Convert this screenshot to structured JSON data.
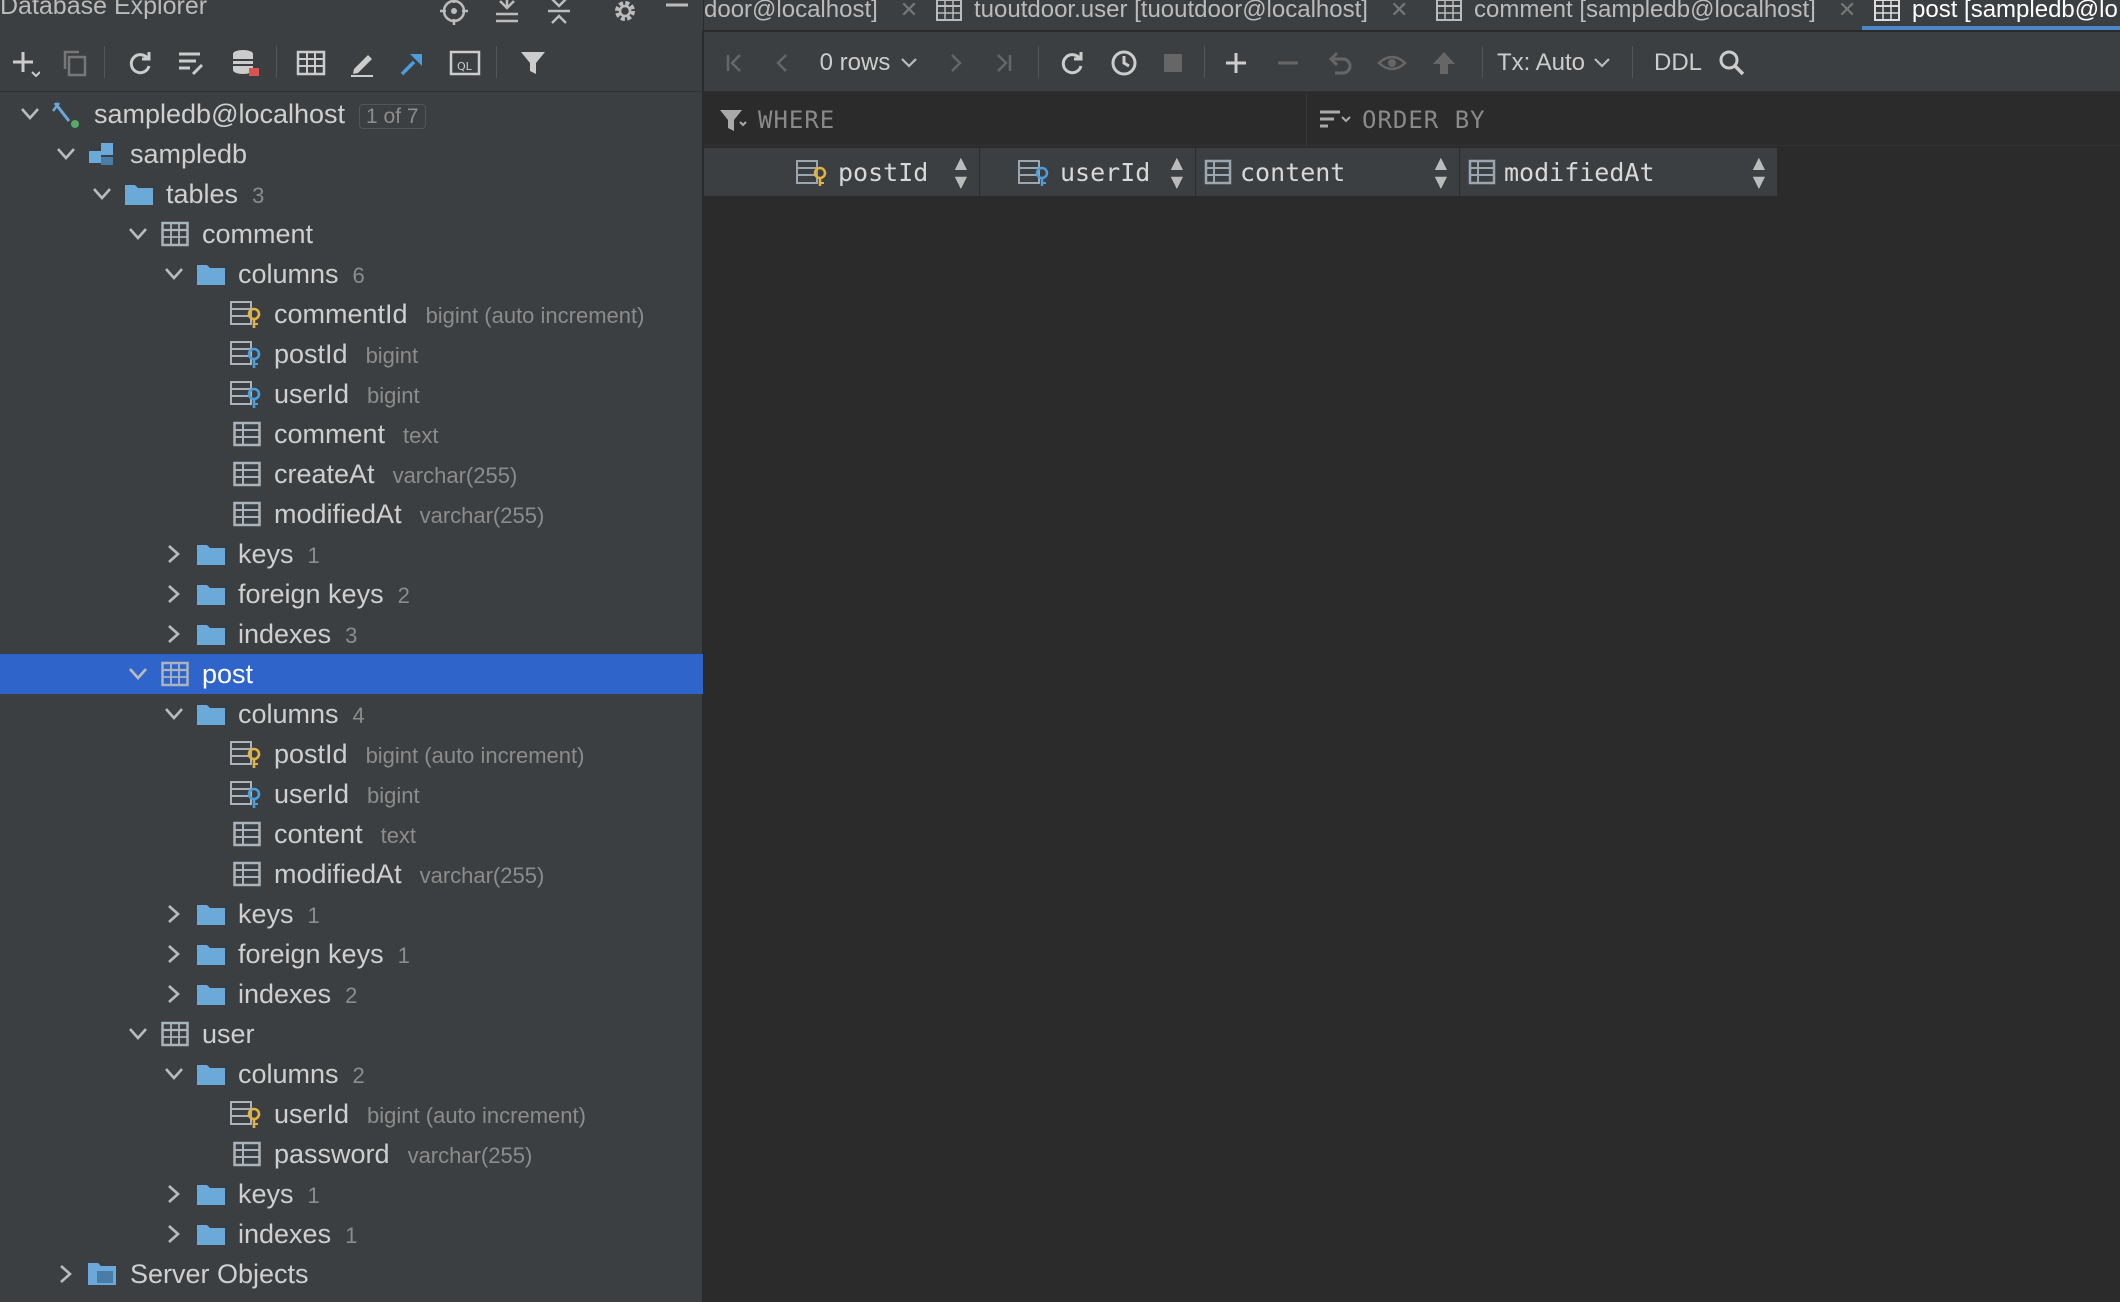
{
  "sidebar": {
    "title": "Database Explorer",
    "tree": {
      "connection": {
        "label": "sampledb@localhost",
        "badge": "1 of 7"
      },
      "database": {
        "label": "sampledb"
      },
      "tables_folder": {
        "label": "tables",
        "count": "3"
      },
      "comment_table": {
        "label": "comment",
        "columns_folder": {
          "label": "columns",
          "count": "6"
        },
        "columns": [
          {
            "name": "commentId",
            "type": "bigint (auto increment)",
            "icon": "primary-key-column-icon"
          },
          {
            "name": "postId",
            "type": "bigint",
            "icon": "foreign-key-column-icon"
          },
          {
            "name": "userId",
            "type": "bigint",
            "icon": "foreign-key-column-icon"
          },
          {
            "name": "comment",
            "type": "text",
            "icon": "column-icon"
          },
          {
            "name": "createAt",
            "type": "varchar(255)",
            "icon": "column-icon"
          },
          {
            "name": "modifiedAt",
            "type": "varchar(255)",
            "icon": "column-icon"
          }
        ],
        "keys": {
          "label": "keys",
          "count": "1"
        },
        "foreign_keys": {
          "label": "foreign keys",
          "count": "2"
        },
        "indexes": {
          "label": "indexes",
          "count": "3"
        }
      },
      "post_table": {
        "label": "post",
        "columns_folder": {
          "label": "columns",
          "count": "4"
        },
        "columns": [
          {
            "name": "postId",
            "type": "bigint (auto increment)",
            "icon": "primary-key-column-icon"
          },
          {
            "name": "userId",
            "type": "bigint",
            "icon": "foreign-key-column-icon"
          },
          {
            "name": "content",
            "type": "text",
            "icon": "column-icon"
          },
          {
            "name": "modifiedAt",
            "type": "varchar(255)",
            "icon": "column-icon"
          }
        ],
        "keys": {
          "label": "keys",
          "count": "1"
        },
        "foreign_keys": {
          "label": "foreign keys",
          "count": "1"
        },
        "indexes": {
          "label": "indexes",
          "count": "2"
        }
      },
      "user_table": {
        "label": "user",
        "columns_folder": {
          "label": "columns",
          "count": "2"
        },
        "columns": [
          {
            "name": "userId",
            "type": "bigint (auto increment)",
            "icon": "primary-key-column-icon"
          },
          {
            "name": "password",
            "type": "varchar(255)",
            "icon": "column-icon"
          }
        ],
        "keys": {
          "label": "keys",
          "count": "1"
        },
        "indexes": {
          "label": "indexes",
          "count": "1"
        }
      },
      "server_objects": {
        "label": "Server Objects"
      }
    }
  },
  "editor": {
    "tabs": [
      {
        "label": "door@localhost]",
        "active": false
      },
      {
        "label": "tuoutdoor.user [tuoutdoor@localhost]",
        "active": false
      },
      {
        "label": "comment [sampledb@localhost]",
        "active": false
      },
      {
        "label": "post [sampledb@lo",
        "active": true
      }
    ],
    "toolbar": {
      "rows_label": "0 rows",
      "tx_label": "Tx: Auto",
      "ddl_label": "DDL"
    },
    "filter": {
      "where_label": "WHERE",
      "order_label": "ORDER BY"
    },
    "columns": [
      {
        "name": "postId",
        "icon": "foreign-key-column-icon"
      },
      {
        "name": "userId",
        "icon": "foreign-key-column-icon"
      },
      {
        "name": "content",
        "icon": "column-icon"
      },
      {
        "name": "modifiedAt",
        "icon": "column-icon"
      }
    ]
  },
  "colors": {
    "panel": "#3c3f41",
    "editor": "#2b2b2b",
    "selection": "#2f65ca",
    "folder": "#6aa9d8",
    "key": "#e3b341"
  }
}
